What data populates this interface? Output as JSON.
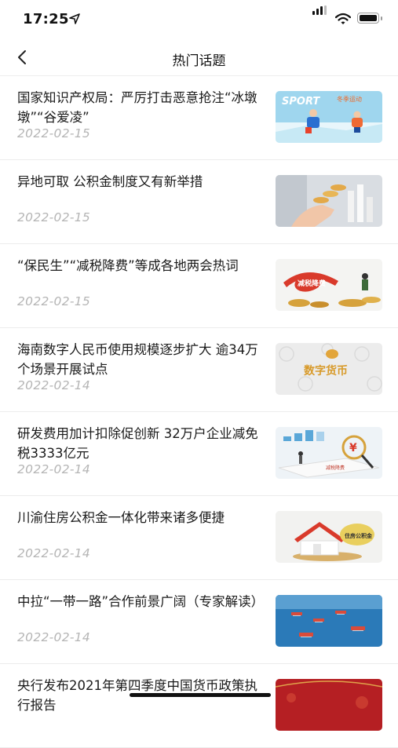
{
  "status": {
    "time": "17:25"
  },
  "nav": {
    "title": "热门话题"
  },
  "articles": [
    {
      "title": "国家知识产权局：严厉打击恶意抢注“冰墩墩”“谷爱凌”",
      "date": "2022-02-15",
      "thumb": "winter-sports-image",
      "thumb_text": "SPORT",
      "thumb_text2": "冬季运动"
    },
    {
      "title": "异地可取 公积金制度又有新举措",
      "date": "2022-02-15",
      "thumb": "coins-hand-image"
    },
    {
      "title": "“保民生”“减税降费”等成各地两会热词",
      "date": "2022-02-15",
      "thumb": "tax-cut-image",
      "thumb_text": "减税降费"
    },
    {
      "title": "海南数字人民币使用规模逐步扩大 逾34万个场景开展试点",
      "date": "2022-02-14",
      "thumb": "digital-rmb-image",
      "thumb_text": "数字货币"
    },
    {
      "title": "研发费用加计扣除促创新 32万户企业减免税3333亿元",
      "date": "2022-02-14",
      "thumb": "tax-reduction-image",
      "thumb_text": "减税降费"
    },
    {
      "title": "川渝住房公积金一体化带来诸多便捷",
      "date": "2022-02-14",
      "thumb": "housing-fund-image",
      "thumb_text": "住房公积金"
    },
    {
      "title": "中拉“一带一路”合作前景广阔（专家解读）",
      "date": "2022-02-14",
      "thumb": "ships-sea-image"
    },
    {
      "title": "央行发布2021年第四季度中国货币政策执行报告",
      "date": "",
      "thumb": "red-banner-image"
    }
  ]
}
